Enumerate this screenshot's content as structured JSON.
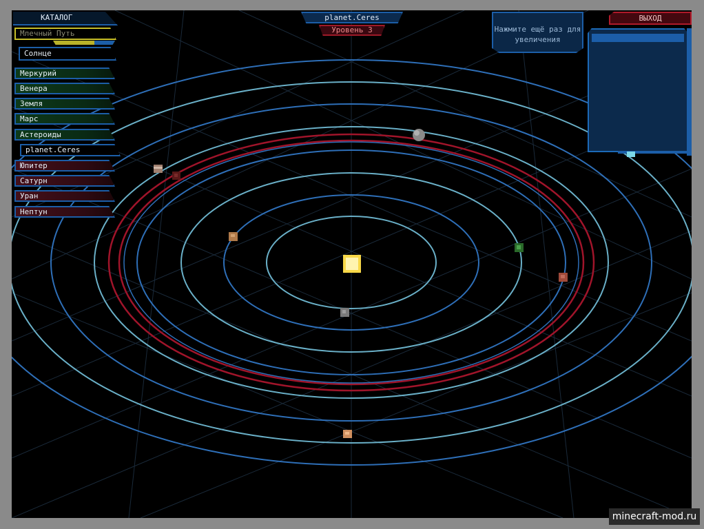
{
  "sidebar": {
    "header": "КАТАЛОГ",
    "galaxy": "Млечный Путь",
    "star": "Солнце",
    "items": [
      {
        "label": "Меркурий"
      },
      {
        "label": "Венера"
      },
      {
        "label": "Земля"
      },
      {
        "label": "Марс"
      },
      {
        "label": "Астероиды"
      },
      {
        "label": "planet.Ceres"
      },
      {
        "label": "Юпитер"
      },
      {
        "label": "Сатурн"
      },
      {
        "label": "Уран"
      },
      {
        "label": "Нептун"
      }
    ]
  },
  "header": {
    "title": "planet.Ceres",
    "level": "Уровень 3"
  },
  "hint": "Нажмите ещё раз для увеличения",
  "exit_label": "ВЫХОД",
  "watermark": "minecraft-mod.ru",
  "colors": {
    "orbit_blue": "#2e6fb8",
    "orbit_cyan": "#6ab0c8",
    "asteroid_red": "#a0142a",
    "sun": "#f8e060",
    "ui_blue": "#1c5ea8",
    "ui_red": "#b01a2a"
  },
  "bodies": [
    {
      "name": "sun",
      "icon": "sun-icon"
    },
    {
      "name": "mercury",
      "icon": "planet-icon"
    },
    {
      "name": "venus",
      "icon": "planet-icon"
    },
    {
      "name": "earth",
      "icon": "planet-icon"
    },
    {
      "name": "mars",
      "icon": "planet-icon"
    },
    {
      "name": "ceres",
      "icon": "planet-icon"
    },
    {
      "name": "jupiter",
      "icon": "planet-icon"
    },
    {
      "name": "saturn",
      "icon": "planet-icon"
    },
    {
      "name": "uranus",
      "icon": "planet-icon"
    },
    {
      "name": "neptune",
      "icon": "planet-icon"
    }
  ]
}
